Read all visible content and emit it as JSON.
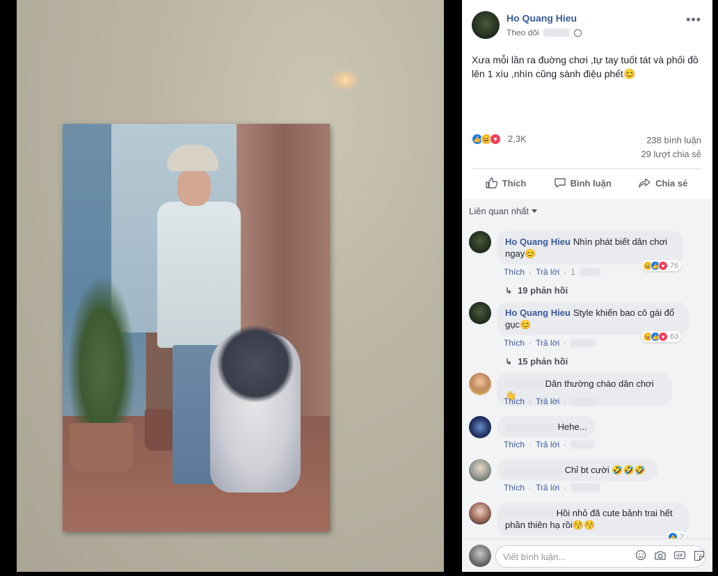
{
  "post": {
    "author": "Ho Quang Hieu",
    "follow_label": "Theo dõi",
    "text": "Xưa mỗi lần ra đuờng chơi ,tự tay tuốt tát và phối đồ lên 1 xíu ,nhìn cũng sành điệu phết😊",
    "reaction_count": "2,3K",
    "comment_count": "238 bình luận",
    "share_count": "29 lượt chia sẻ"
  },
  "actions": {
    "like": "Thích",
    "comment": "Bình luận",
    "share": "Chia sẻ"
  },
  "sort_label": "Liên quan nhất",
  "comments": [
    {
      "name": "Ho Quang Hieu",
      "text": "Nhìn phát biết dân chơi ngay😊",
      "like": "Thích",
      "reply": "Trả lời",
      "time": "1",
      "reactions": "76",
      "replies": "19 phản hồi"
    },
    {
      "name": "Ho Quang Hieu",
      "text": "Style khiến bao cô gái đổ gục😊",
      "like": "Thích",
      "reply": "Trả lời",
      "reactions": "63",
      "replies": "15 phản hồi"
    },
    {
      "text": "Dân thường chào dân chơi 👋",
      "like": "Thích",
      "reply": "Trả lời"
    },
    {
      "text": "Hehe...",
      "like": "Thích",
      "reply": "Trả lời"
    },
    {
      "text": "Chỉ bt cười 🤣🤣🤣",
      "like": "Thích",
      "reply": "Trả lời"
    },
    {
      "text": "Hồi nhỏ đã cute bảnh trai hết phần thiên hạ rồi😚😚",
      "reactions": "2"
    }
  ],
  "composer": {
    "placeholder": "Viết bình luận..."
  },
  "icons": {
    "options": "more-options-icon",
    "globe": "globe-icon",
    "like": "thumbs-up-icon",
    "comment": "speech-bubble-icon",
    "share": "share-arrow-icon",
    "emoji": "smiley-icon",
    "camera": "camera-icon",
    "gif": "gif-icon",
    "sticker": "sticker-icon"
  },
  "colors": {
    "link": "#385898",
    "like_blue": "#1877f2",
    "haha_yellow": "#f7b928",
    "love_red": "#f33e58"
  }
}
